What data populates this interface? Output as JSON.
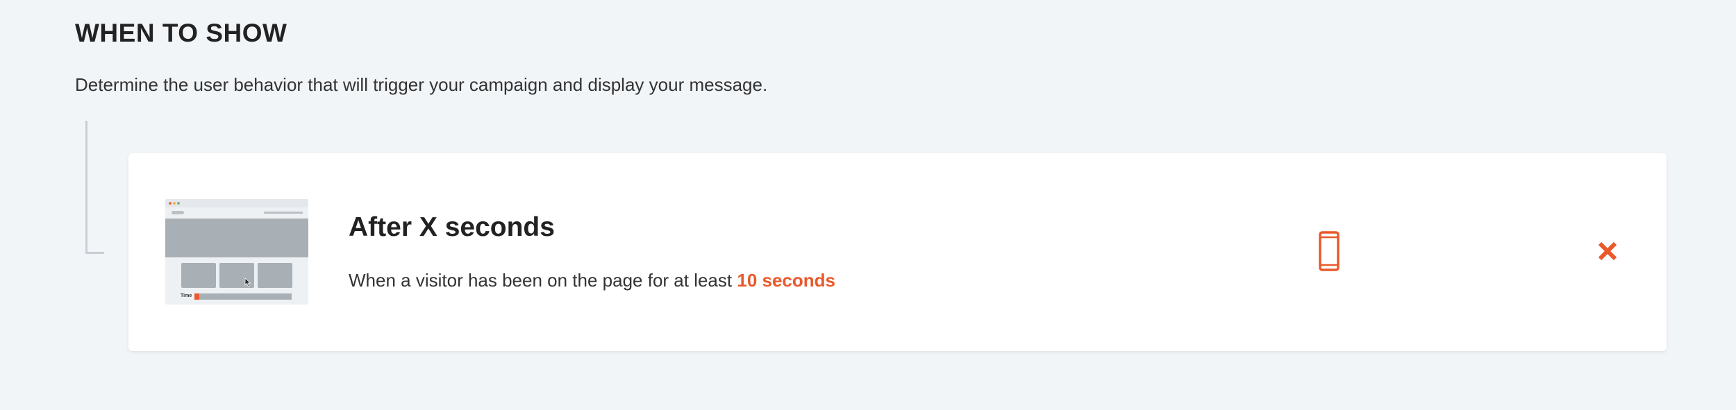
{
  "section": {
    "title": "WHEN TO SHOW",
    "description": "Determine the user behavior that will trigger your campaign and display your message."
  },
  "trigger": {
    "title": "After X seconds",
    "description_prefix": "When a visitor has been on the page for at least",
    "description_value": "10 seconds",
    "thumbnail": {
      "time_label": "Time",
      "time_progress_fraction": 0.05
    },
    "device_icon": "mobile-phone-icon",
    "remove_icon": "close-x-icon"
  },
  "colors": {
    "accent": "#e9592b",
    "background": "#f2f5f8",
    "card": "#ffffff",
    "text": "#222222",
    "thumbnail_gray": "#a8afb5"
  }
}
